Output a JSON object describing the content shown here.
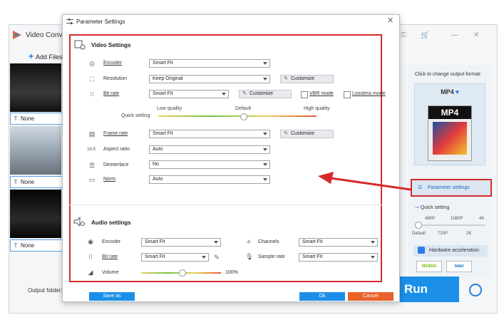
{
  "background_app": {
    "title": "Video Conv",
    "add_files": "Add Files",
    "none_labels": [
      "None",
      "None",
      "None"
    ],
    "output_folder_label": "Output folder:",
    "right_panel": {
      "click_to_change": "Click to change output format:",
      "format": "MP4",
      "format_icon_text": "MP4",
      "parameter_settings": "Parameter settings",
      "quick_setting": "Quick setting",
      "quick_ticks_top": [
        "480P",
        "1080P",
        "4K"
      ],
      "quick_ticks_bottom": [
        "Default",
        "720P",
        "2K"
      ],
      "hardware_acceleration": "Hardware acceleration",
      "gpu_brands": [
        "NVIDIA",
        "Intel"
      ],
      "run": "Run"
    }
  },
  "dialog": {
    "title": "Parameter Settings",
    "video_settings": {
      "title": "Video Settings",
      "encoder": {
        "label": "Encoder",
        "value": "Smart Fit"
      },
      "resolution": {
        "label": "Resolution",
        "value": "Keep Original",
        "customize": "Customize"
      },
      "bitrate": {
        "label": "Bit rate",
        "value": "Smart Fit",
        "customize": "Customize",
        "vbr_mode": "VBR mode",
        "lossless_mode": "Lossless mode"
      },
      "quick_setting": {
        "label": "Quick setting",
        "low": "Low quality",
        "default": "Default",
        "high": "High quality"
      },
      "frame_rate": {
        "label": "Frame rate",
        "value": "Smart Fit",
        "customize": "Customize"
      },
      "aspect_ratio": {
        "label": "Aspect ratio",
        "value": "Auto"
      },
      "deinterlace": {
        "label": "Deinterlace",
        "value": "No"
      },
      "norm": {
        "label": "Norm",
        "value": "Auto"
      }
    },
    "audio_settings": {
      "title": "Audio settings",
      "encoder": {
        "label": "Encoder",
        "value": "Smart Fit"
      },
      "channels": {
        "label": "Channels",
        "value": "Smart Fit"
      },
      "bitrate": {
        "label": "Bit rate",
        "value": "Smart Fit"
      },
      "sample_rate": {
        "label": "Sample rate",
        "value": "Smart Fit"
      },
      "volume": {
        "label": "Volume",
        "value": "100%"
      }
    },
    "buttons": {
      "save_as": "Save as",
      "ok": "Ok",
      "cancel": "Cancel"
    }
  },
  "colors": {
    "accent": "#1b8fe8",
    "highlight": "#d62a2a",
    "cancel": "#e8622a"
  }
}
